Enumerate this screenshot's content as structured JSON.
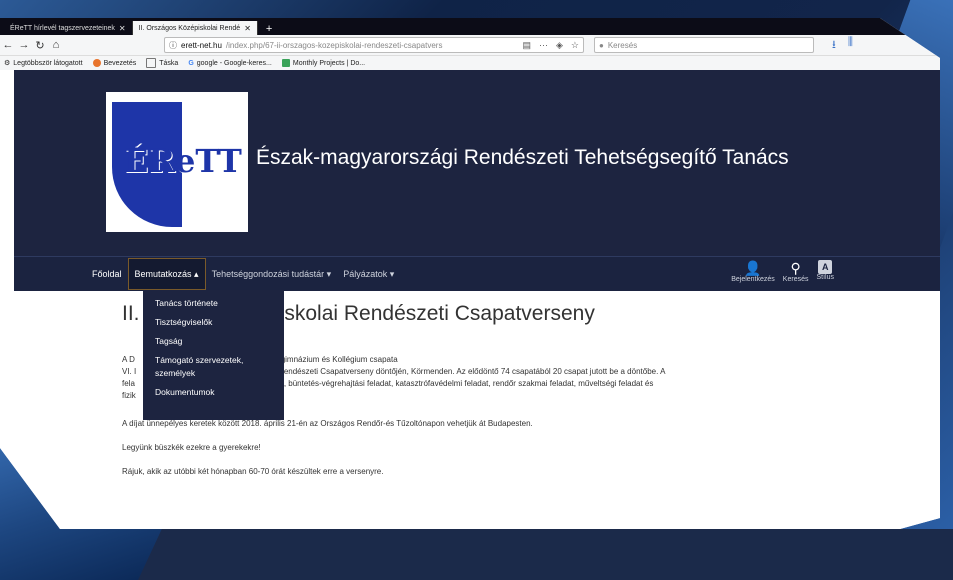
{
  "browser": {
    "tabs": [
      {
        "label": "ÉReTT hírlevél tagszervezeteinek",
        "active": false
      },
      {
        "label": "II. Országos Középiskolai Rendé",
        "active": true
      }
    ],
    "url_host": "erett-net.hu",
    "url_path": "/index.php/67-ii-orszagos-kozepiskolai-rendeszeti-csapatvers",
    "search_placeholder": "Keresés",
    "bookmarks": [
      {
        "label": "Legtöbbször látogatott"
      },
      {
        "label": "Bevezetés"
      },
      {
        "label": "Táska"
      },
      {
        "label": "google - Google-keres..."
      },
      {
        "label": "Monthly Projects | Do..."
      }
    ]
  },
  "site": {
    "logo_text": "ÉReTT",
    "title": "Észak-magyarországi Rendészeti Tehetségsegítő Tanács"
  },
  "nav": {
    "items": [
      {
        "label": "Főoldal"
      },
      {
        "label": "Bemutatkozás ▴"
      },
      {
        "label": "Tehetséggondozási tudástár ▾"
      },
      {
        "label": "Pályázatok ▾"
      }
    ],
    "util": {
      "login": "Bejelentkezés",
      "search": "Keresés",
      "style": "Stílus",
      "style_glyph": "A"
    }
  },
  "dropdown": {
    "items": [
      "Tanács története",
      "Tisztségviselők",
      "Tagság",
      "Támogató szervezetek,",
      "személyek",
      "Dokumentumok"
    ]
  },
  "article": {
    "heading_start": "II.",
    "heading_rest": "piskolai Rendészeti Csapatverseny",
    "p1a": "A D                                              ázium, Szakgimnázium és Kollégium csapata",
    "p1b": "VI. I                                             özépiskolai Rendészeti Csapatverseny döntőjén, Körmenden. Az elődöntő 74 csapatából 20 csapat jutott be a döntőbe. A",
    "p1c": "fela                                              akadálypálya, büntetés-végrehajtási feladat, katasztrófavédelmi feladat, rendőr szakmai feladat, műveltségi feladat és",
    "p1d": "fizik",
    "p2": "A díjat ünnepélyes keretek között 2018. április 21-én az Országos Rendőr-és Tűzoltónapon vehetjük át Budapesten.",
    "p3": "Legyünk büszkék ezekre a gyerekekre!",
    "p4": "Rájuk, akik az utóbbi két hónapban 60-70 órát készültek erre a versenyre."
  },
  "colors": {
    "header_bg": "#1d2440",
    "nav_bg": "#1b2340",
    "logo_blue": "#1e35a8"
  }
}
